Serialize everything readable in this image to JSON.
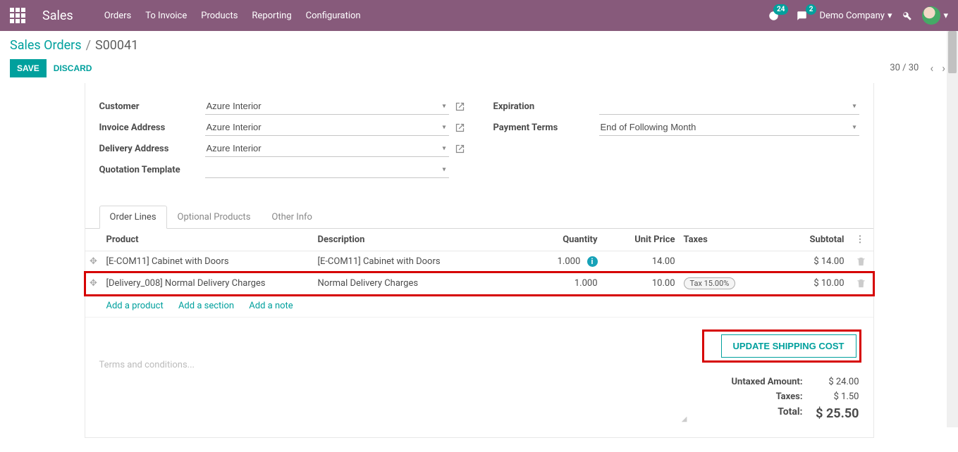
{
  "nav": {
    "brand": "Sales",
    "menu": [
      "Orders",
      "To Invoice",
      "Products",
      "Reporting",
      "Configuration"
    ],
    "activities_count": "24",
    "messages_count": "2",
    "company": "Demo Company"
  },
  "breadcrumb": {
    "parent": "Sales Orders",
    "sep": "/",
    "current": "S00041"
  },
  "actions": {
    "save": "SAVE",
    "discard": "DISCARD"
  },
  "pager": {
    "text": "30 / 30"
  },
  "form": {
    "labels": {
      "customer": "Customer",
      "invoice_addr": "Invoice Address",
      "delivery_addr": "Delivery Address",
      "quotation_tpl": "Quotation Template",
      "expiration": "Expiration",
      "payment_terms": "Payment Terms"
    },
    "values": {
      "customer": "Azure Interior",
      "invoice_addr": "Azure Interior",
      "delivery_addr": "Azure Interior",
      "quotation_tpl": "",
      "expiration": "",
      "payment_terms": "End of Following Month"
    }
  },
  "tabs": {
    "order_lines": "Order Lines",
    "optional": "Optional Products",
    "other": "Other Info"
  },
  "cols": {
    "product": "Product",
    "description": "Description",
    "quantity": "Quantity",
    "unit_price": "Unit Price",
    "taxes": "Taxes",
    "subtotal": "Subtotal"
  },
  "lines": [
    {
      "product": "[E-COM11] Cabinet with Doors",
      "description": "[E-COM11] Cabinet with Doors",
      "qty": "1.000",
      "info": true,
      "price": "14.00",
      "tax": "",
      "subtotal": "$ 14.00"
    },
    {
      "product": "[Delivery_008] Normal Delivery Charges",
      "description": "Normal Delivery Charges",
      "qty": "1.000",
      "info": false,
      "price": "10.00",
      "tax": "Tax 15.00%",
      "subtotal": "$ 10.00"
    }
  ],
  "add": {
    "product": "Add a product",
    "section": "Add a section",
    "note": "Add a note"
  },
  "terms_placeholder": "Terms and conditions...",
  "update_shipping": "UPDATE SHIPPING COST",
  "totals": {
    "untaxed_label": "Untaxed Amount:",
    "untaxed": "$ 24.00",
    "taxes_label": "Taxes:",
    "taxes": "$ 1.50",
    "total_label": "Total:",
    "total": "$ 25.50"
  }
}
